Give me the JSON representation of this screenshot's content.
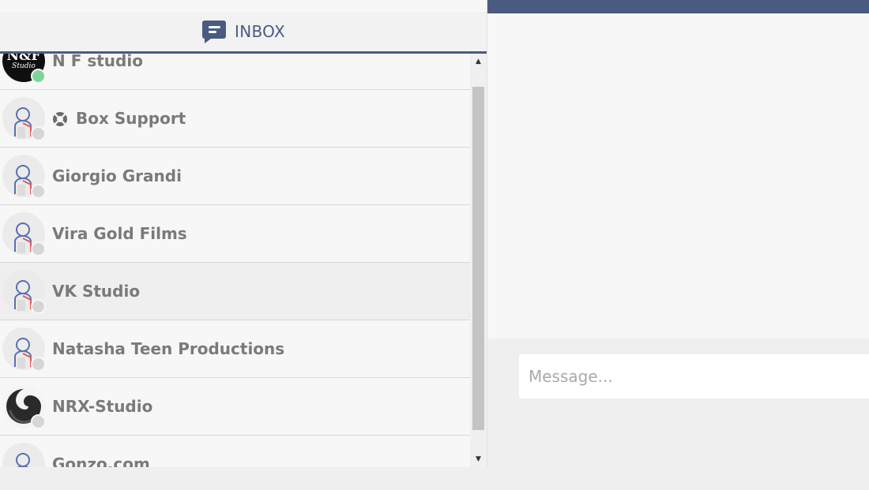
{
  "header": {
    "title": "INBOX",
    "icon": "chat-bubble-icon",
    "accent": "#4a5b82"
  },
  "conversations": [
    {
      "name": "N F studio",
      "avatar": "nf-studio-logo",
      "logo_text": "N&F",
      "logo_sub": "Studio",
      "status": "online"
    },
    {
      "name": "Box Support",
      "avatar": "default-user",
      "status": "offline",
      "badge_icon": "lifebuoy-icon"
    },
    {
      "name": "Giorgio Grandi",
      "avatar": "default-user",
      "status": "offline"
    },
    {
      "name": "Vira Gold Films",
      "avatar": "default-user",
      "status": "offline"
    },
    {
      "name": "VK Studio",
      "avatar": "default-user",
      "status": "offline",
      "highlighted": true
    },
    {
      "name": "Natasha Teen Productions",
      "avatar": "default-user",
      "status": "offline"
    },
    {
      "name": "NRX-Studio",
      "avatar": "swirl-logo",
      "status": "offline"
    },
    {
      "name": "Gonzo.com",
      "avatar": "default-user",
      "status": "offline"
    }
  ],
  "composer": {
    "placeholder": "Message..."
  },
  "colors": {
    "online": "#7fd49a",
    "offline": "#d6d6d6",
    "topbar": "#4a5b82",
    "name_text": "#7a7a7a"
  }
}
